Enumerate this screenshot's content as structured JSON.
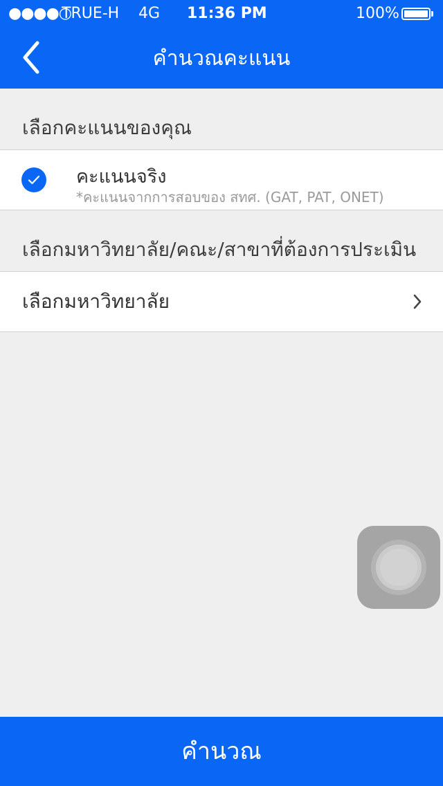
{
  "status_bar": {
    "signal": "●●●●○",
    "carrier": "TRUE-H",
    "network": "4G",
    "time": "11:36 PM",
    "battery_text": "100%",
    "battery_level": 1.0
  },
  "nav": {
    "back_icon": "chevron-left-icon",
    "title": "คำนวณคะแนน"
  },
  "score_section": {
    "header": "เลือกคะแนนของคุณ",
    "option": {
      "title": "คะแนนจริง",
      "subtitle": "*คะแนนจากการสอบของ สทศ. (GAT, PAT, ONET)",
      "checked": true,
      "icon": "checkmark-icon"
    }
  },
  "university_section": {
    "header": "เลือกมหาวิทยาลัย/คณะ/สาขาที่ต้องการประเมิน",
    "row_label": "เลือกมหาวิทยาลัย",
    "row_icon": "chevron-right-icon"
  },
  "footer": {
    "calculate_label": "คำนวณ"
  },
  "colors": {
    "primary": "#0a66f5",
    "background": "#efefef",
    "row_background": "#ffffff",
    "subtitle_text": "#9a9a9a"
  }
}
